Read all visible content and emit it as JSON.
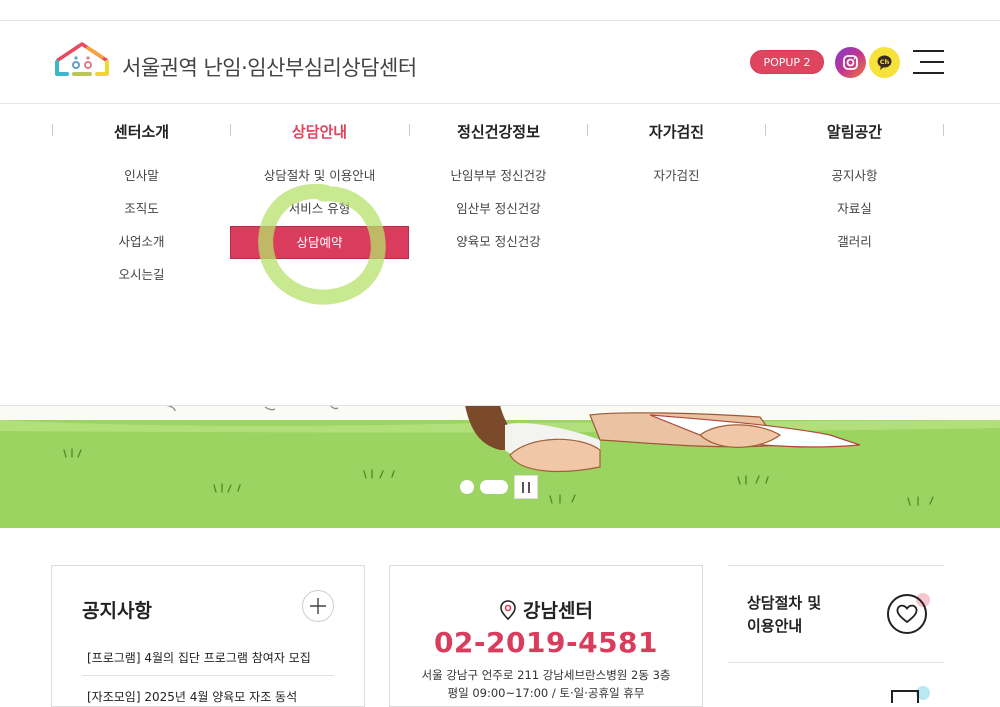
{
  "site": {
    "title": "서울권역 난임·임산부심리상담센터"
  },
  "header": {
    "popup_label": "POPUP 2"
  },
  "nav": [
    {
      "title": "센터소개",
      "active": false,
      "items": [
        "인사말",
        "조직도",
        "사업소개",
        "오시는길"
      ]
    },
    {
      "title": "상담안내",
      "active": true,
      "items": [
        "상담절차 및 이용안내",
        "서비스 유형",
        "상담예약"
      ],
      "highlighted_index": 2
    },
    {
      "title": "정신건강정보",
      "active": false,
      "items": [
        "난임부부 정신건강",
        "임산부 정신건강",
        "양육모 정신건강"
      ]
    },
    {
      "title": "자가검진",
      "active": false,
      "items": [
        "자가검진"
      ]
    },
    {
      "title": "알림공간",
      "active": false,
      "items": [
        "공지사항",
        "자료실",
        "갤러리"
      ]
    }
  ],
  "notice": {
    "title": "공지사항",
    "items": [
      "[프로그램] 4월의 집단 프로그램 참여자 모집",
      "[자조모임] 2025년 4월 양육모 자조 동석"
    ]
  },
  "center": {
    "name": "강남센터",
    "phone": "02-2019-4581",
    "address": "서울 강남구 언주로 211 강남세브란스병원 2동 3층",
    "hours": "평일 09:00~17:00 / 토·일·공휴일 휴무"
  },
  "quick": {
    "label_line1": "상담절차 및",
    "label_line2": "이용안내"
  },
  "colors": {
    "accent": "#e0455f",
    "highlight": "#d93c5c",
    "grass": "#9cd461"
  }
}
